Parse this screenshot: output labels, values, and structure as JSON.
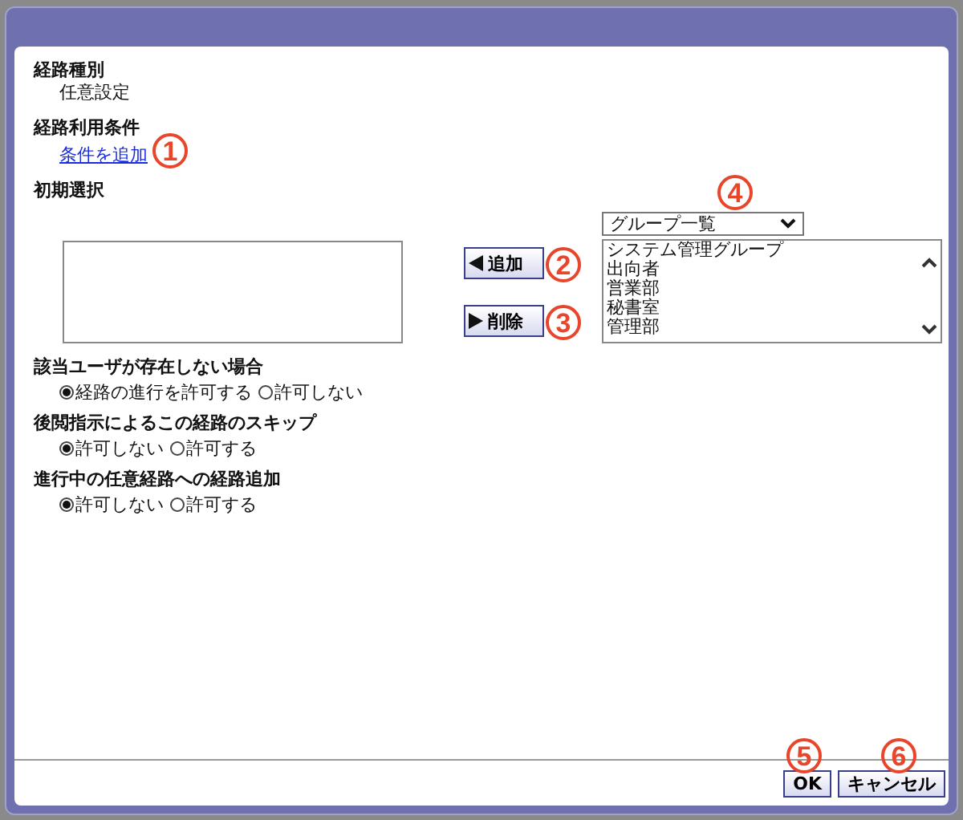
{
  "route_type": {
    "label": "経路種別",
    "value": "任意設定"
  },
  "route_conditions": {
    "label": "経路利用条件",
    "link": "条件を追加"
  },
  "initial_selection": {
    "label": "初期選択",
    "add_button": "追加",
    "remove_button": "削除",
    "group_dropdown": "グループ一覧",
    "groups": [
      {
        "label": "システム管理グループ",
        "selected": false
      },
      {
        "label": "出向者",
        "selected": false
      },
      {
        "label": "営業部",
        "selected": false
      },
      {
        "label": "秘書室",
        "selected": false
      },
      {
        "label": "管理部",
        "selected": false
      }
    ]
  },
  "options": [
    {
      "label": "該当ユーザが存在しない場合",
      "choices": [
        {
          "label": "経路の進行を許可する",
          "selected": true
        },
        {
          "label": "許可しない",
          "selected": false
        }
      ]
    },
    {
      "label": "後閲指示によるこの経路のスキップ",
      "choices": [
        {
          "label": "許可しない",
          "selected": true
        },
        {
          "label": "許可する",
          "selected": false
        }
      ]
    },
    {
      "label": "進行中の任意経路への経路追加",
      "choices": [
        {
          "label": "許可しない",
          "selected": true
        },
        {
          "label": "許可する",
          "selected": false
        }
      ]
    }
  ],
  "buttons": {
    "ok": "OK",
    "cancel": "キャンセル"
  },
  "annotations": [
    "1",
    "2",
    "3",
    "4",
    "5",
    "6"
  ]
}
